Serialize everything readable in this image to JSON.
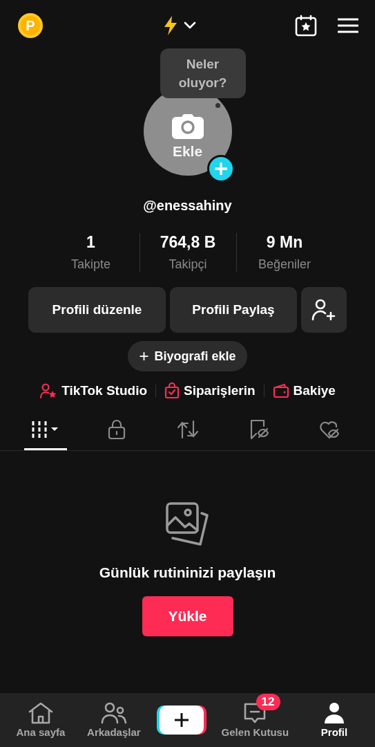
{
  "top_bar": {
    "coin_label": "P"
  },
  "avatar": {
    "label": "Ekle",
    "tooltip": "Neler oluyor?"
  },
  "username": "@enessahiny",
  "stats": [
    {
      "value": "1",
      "label": "Takipte"
    },
    {
      "value": "764,8 B",
      "label": "Takipçi"
    },
    {
      "value": "9 Mn",
      "label": "Beğeniler"
    }
  ],
  "buttons": [
    "Profili düzenle",
    "Profili Paylaş"
  ],
  "bio_button": {
    "icon": "+",
    "label": "Biyografi ekle"
  },
  "links": [
    {
      "kind": "studio",
      "label": "TikTok Studio"
    },
    {
      "kind": "orders",
      "label": "Siparişlerin"
    },
    {
      "kind": "wallet",
      "label": "Bakiye"
    }
  ],
  "tabs": [
    {
      "kind": "grid",
      "selected": true
    },
    {
      "kind": "lock",
      "selected": false
    },
    {
      "kind": "repost",
      "selected": false
    },
    {
      "kind": "saved",
      "selected": false
    },
    {
      "kind": "liked",
      "selected": false
    }
  ],
  "empty_state": {
    "message": "Günlük rutininizi paylaşın",
    "button": "Yükle"
  },
  "nav": [
    {
      "kind": "home",
      "label": "Ana sayfa",
      "selected": false
    },
    {
      "kind": "friends",
      "label": "Arkadaşlar",
      "selected": false
    },
    {
      "kind": "create"
    },
    {
      "kind": "inbox",
      "label": "Gelen Kutusu",
      "badge": "12",
      "selected": false
    },
    {
      "kind": "profile",
      "label": "Profil",
      "selected": true
    }
  ]
}
